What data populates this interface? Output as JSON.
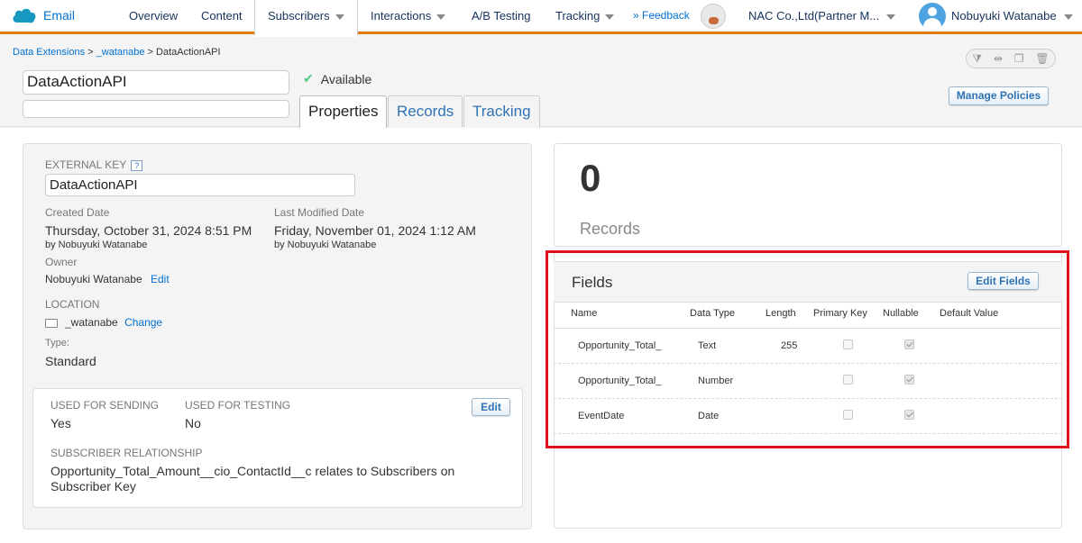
{
  "app": {
    "brand_label": "Email"
  },
  "nav": {
    "overview": "Overview",
    "content": "Content",
    "subscribers": "Subscribers",
    "interactions": "Interactions",
    "ab_testing": "A/B Testing",
    "tracking": "Tracking",
    "feedback": "» Feedback",
    "account": "NAC Co.,Ltd(Partner M...",
    "user": "Nobuyuki Watanabe"
  },
  "breadcrumb": {
    "item1": "Data Extensions",
    "sep": " > ",
    "item2": "_watanabe",
    "item3": "DataActionAPI"
  },
  "header": {
    "name_value": "DataActionAPI",
    "description_value": "",
    "status": "Available",
    "manage_policies": "Manage Policies"
  },
  "tabs": {
    "properties": "Properties",
    "records": "Records",
    "tracking": "Tracking"
  },
  "properties": {
    "external_key_label": "EXTERNAL KEY",
    "help_glyph": "?",
    "external_key_value": "DataActionAPI",
    "created_label": "Created Date",
    "created_value": "Thursday, October 31, 2024 8:51 PM",
    "created_by": "by Nobuyuki Watanabe",
    "modified_label": "Last Modified Date",
    "modified_value": "Friday, November 01, 2024 1:12 AM",
    "modified_by": "by Nobuyuki Watanabe",
    "owner_label": "Owner",
    "owner_value": "Nobuyuki Watanabe",
    "owner_edit": "Edit",
    "location_label": "LOCATION",
    "location_value": "_watanabe",
    "location_change": "Change",
    "type_label": "Type:",
    "type_value": "Standard",
    "sending_label": "USED FOR SENDING",
    "sending_value": "Yes",
    "testing_label": "USED FOR TESTING",
    "testing_value": "No",
    "card_edit": "Edit",
    "relationship_label": "SUBSCRIBER RELATIONSHIP",
    "relationship_line1": "Opportunity_Total_Amount__cio_ContactId__c relates to Subscribers on",
    "relationship_line2": "Subscriber Key"
  },
  "records": {
    "count": "0",
    "label": "Records"
  },
  "fields": {
    "title": "Fields",
    "edit_button": "Edit Fields",
    "columns": {
      "name": "Name",
      "data_type": "Data Type",
      "length": "Length",
      "primary_key": "Primary Key",
      "nullable": "Nullable",
      "default_value": "Default Value"
    },
    "rows": [
      {
        "name": "Opportunity_Total_",
        "data_type": "Text",
        "length": "255",
        "primary_key": false,
        "nullable": true,
        "default_value": ""
      },
      {
        "name": "Opportunity_Total_",
        "data_type": "Number",
        "length": "",
        "primary_key": false,
        "nullable": true,
        "default_value": ""
      },
      {
        "name": "EventDate",
        "data_type": "Date",
        "length": "",
        "primary_key": false,
        "nullable": true,
        "default_value": ""
      }
    ]
  },
  "colors": {
    "accent": "#e07b0b",
    "link": "#0070d2",
    "highlight": "#e0111f",
    "brand": "#1798c1"
  }
}
